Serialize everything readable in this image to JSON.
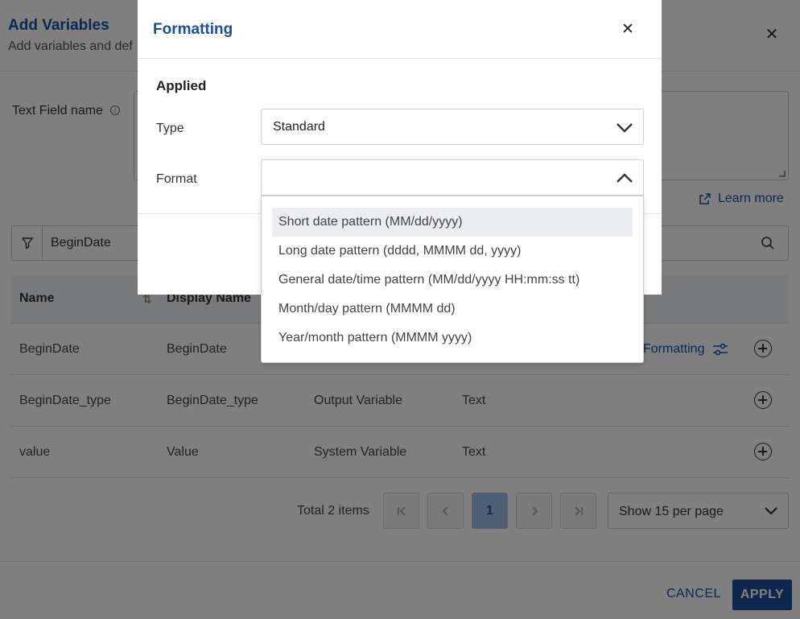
{
  "background": {
    "title": "Add Variables",
    "subtitle": "Add variables and def",
    "close_icon": "close-icon",
    "text_field": {
      "label": "Text Field name",
      "info_icon": "info-icon"
    },
    "learn_more": "Learn more",
    "search": {
      "filter_icon": "filter-icon",
      "value": "BeginDate",
      "search_icon": "search-icon"
    },
    "table": {
      "headers": [
        "Name",
        "Display Name"
      ],
      "rows": [
        {
          "name": "BeginDate",
          "display_name": "BeginDate",
          "type": "",
          "data_type": "",
          "action": "Formatting"
        },
        {
          "name": "BeginDate_type",
          "display_name": "BeginDate_type",
          "type": "Output Variable",
          "data_type": "Text",
          "action": ""
        },
        {
          "name": "value",
          "display_name": "Value",
          "type": "System Variable",
          "data_type": "Text",
          "action": ""
        }
      ]
    },
    "pagination": {
      "total": "Total 2 items",
      "current_page": "1",
      "per_page": "Show 15 per page"
    },
    "footer": {
      "cancel": "CANCEL",
      "apply": "APPLY"
    }
  },
  "modal": {
    "title": "Formatting",
    "close_icon": "close-icon",
    "section": "Applied",
    "type_label": "Type",
    "type_value": "Standard",
    "format_label": "Format",
    "format_value": "",
    "format_options": [
      "Short date pattern (MM/dd/yyyy)",
      "Long date pattern (dddd, MMMM dd, yyyy)",
      "General date/time pattern (MM/dd/yyyy HH:mm:ss tt)",
      "Month/day pattern (MMMM dd)",
      "Year/month pattern (MMMM yyyy)"
    ],
    "highlighted_option_index": 0
  },
  "colors": {
    "accent": "#1a4f9c",
    "overlay": "rgba(0,0,0,0.5)",
    "active_page": "#9fc0ea"
  }
}
